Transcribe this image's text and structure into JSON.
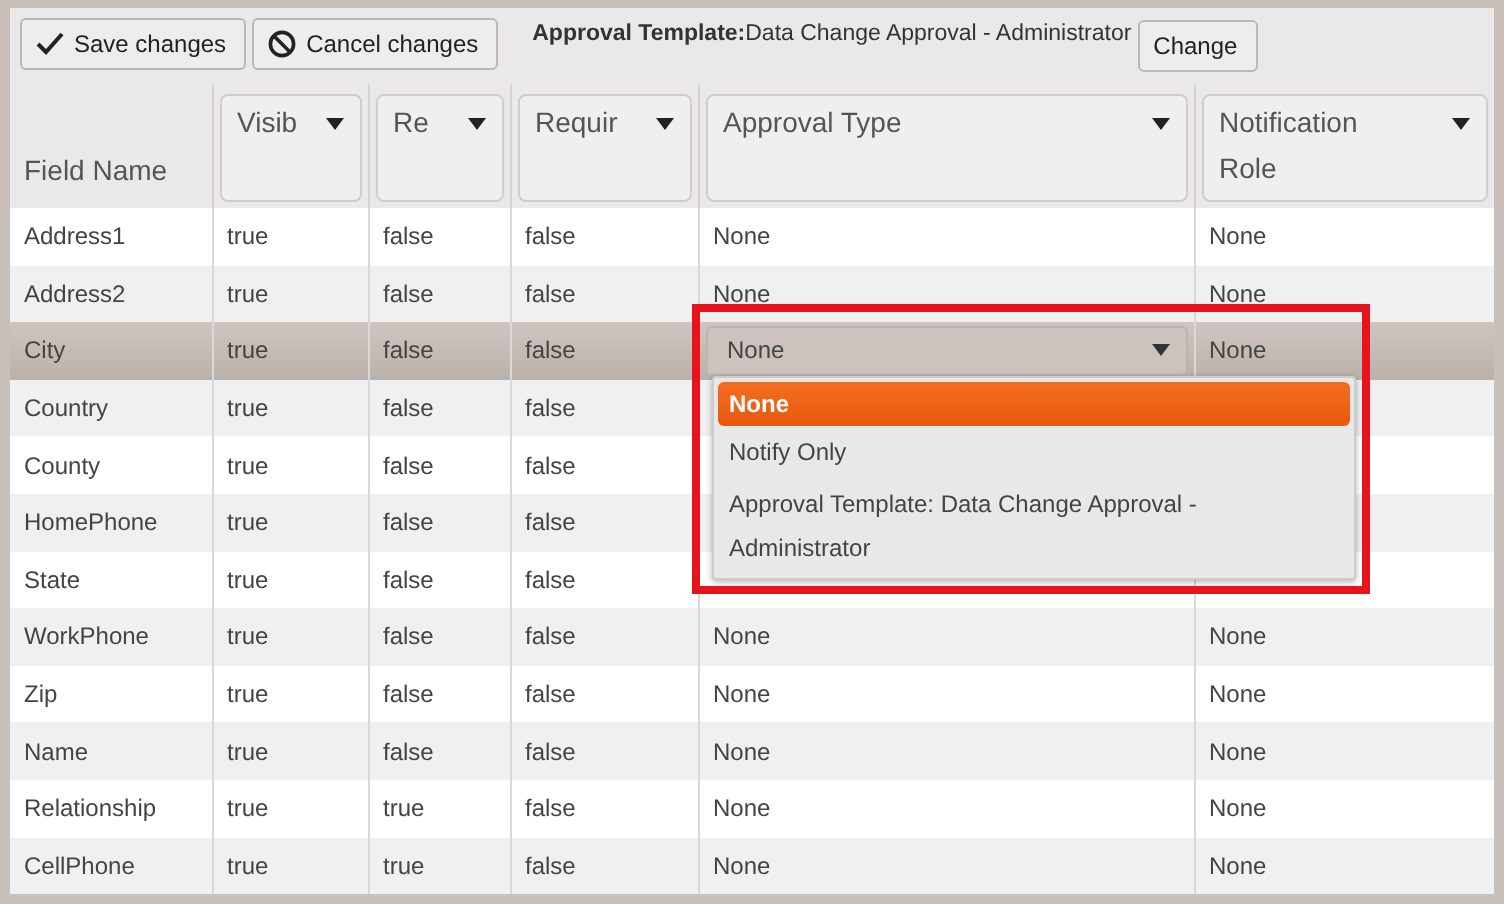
{
  "toolbar": {
    "buttons": [
      {
        "label": "Save changes",
        "kind": "save"
      },
      {
        "label": "Cancel changes",
        "kind": "cancel"
      }
    ],
    "template_label": "Approval Template:",
    "template_value": "Data Change Approval - Administrator",
    "change_button": "Change"
  },
  "table": {
    "columns": [
      {
        "label": "Field Name",
        "filter": false
      },
      {
        "label": "Visib",
        "filter": true
      },
      {
        "label": "Re",
        "filter": true
      },
      {
        "label": "Requir",
        "filter": true
      },
      {
        "label": "Approval Type",
        "filter": true
      },
      {
        "label": "Notification Role",
        "filter": true
      }
    ],
    "rows": [
      {
        "cells": [
          "Address1",
          "true",
          "false",
          "false",
          "None",
          "None"
        ],
        "selected": false
      },
      {
        "cells": [
          "Address2",
          "true",
          "false",
          "false",
          "None",
          "None"
        ],
        "selected": false
      },
      {
        "cells": [
          "City",
          "true",
          "false",
          "false",
          "None",
          "None"
        ],
        "selected": true,
        "dropdown": [
          {
            "label": "None",
            "selected": true
          },
          {
            "label": "Notify Only",
            "selected": false
          },
          {
            "label": "Approval Template: Data Change Approval - Administrator",
            "selected": false
          }
        ]
      },
      {
        "cells": [
          "Country",
          "true",
          "false",
          "false"
        ],
        "selected": false
      },
      {
        "cells": [
          "County",
          "true",
          "false",
          "false"
        ],
        "selected": false
      },
      {
        "cells": [
          "HomePhone",
          "true",
          "false",
          "false"
        ],
        "selected": false
      },
      {
        "cells": [
          "State",
          "true",
          "false",
          "false"
        ],
        "selected": false
      },
      {
        "cells": [
          "WorkPhone",
          "true",
          "false",
          "false",
          "None",
          "None"
        ],
        "selected": false
      },
      {
        "cells": [
          "Zip",
          "true",
          "false",
          "false",
          "None",
          "None"
        ],
        "selected": false
      },
      {
        "cells": [
          "Name",
          "true",
          "false",
          "false",
          "None",
          "None"
        ],
        "selected": false
      },
      {
        "cells": [
          "Relationship",
          "true",
          "true",
          "false",
          "None",
          "None"
        ],
        "selected": false
      },
      {
        "cells": [
          "CellPhone",
          "true",
          "true",
          "false",
          "None",
          "None"
        ],
        "selected": false
      }
    ]
  }
}
